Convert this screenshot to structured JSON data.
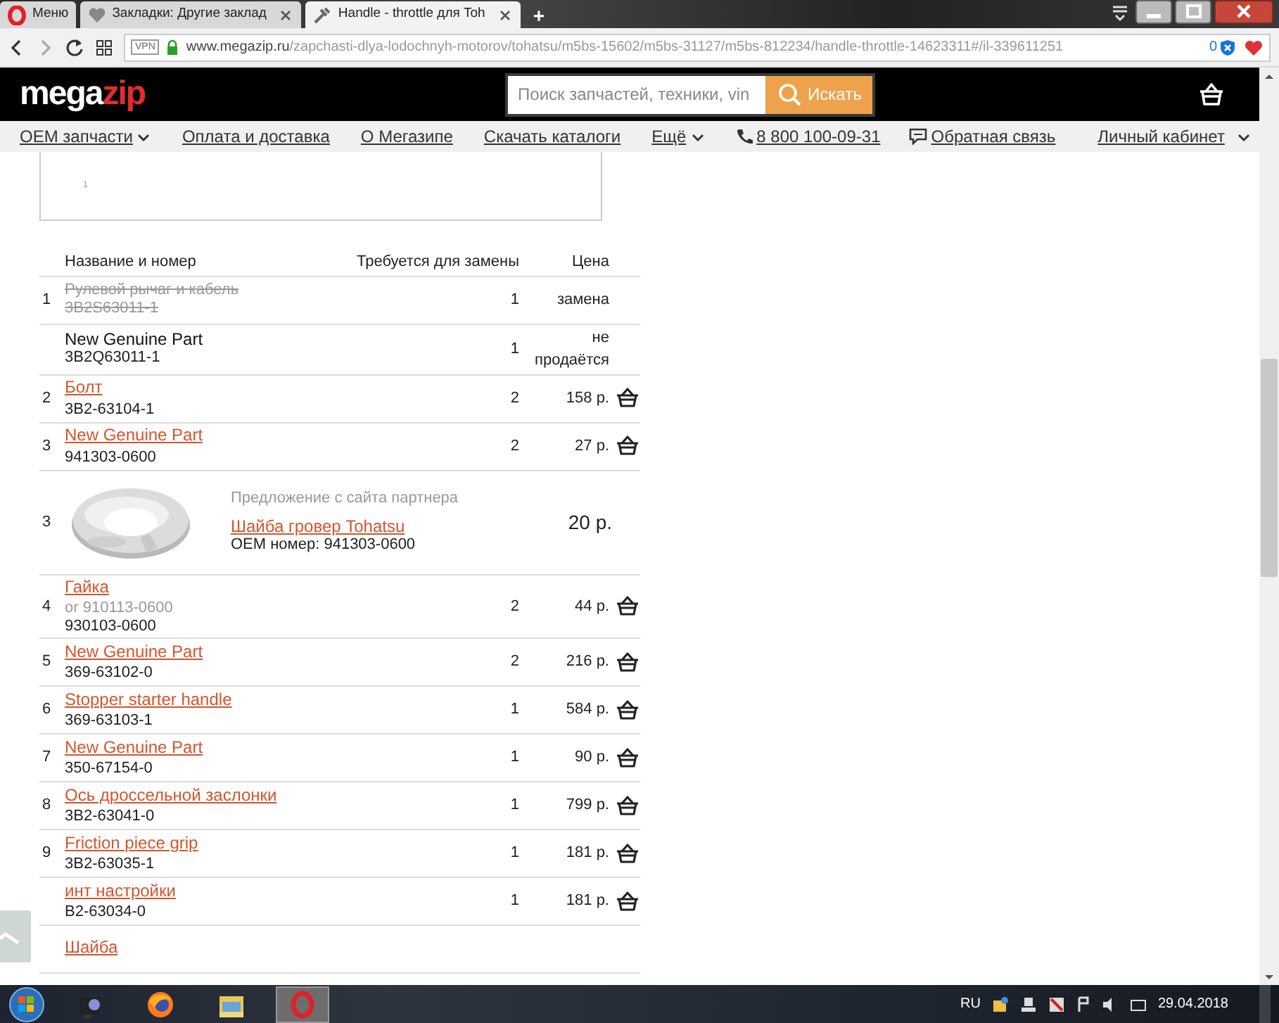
{
  "browser": {
    "tabs": [
      {
        "label": "Меню",
        "selected": false,
        "kind": "menu"
      },
      {
        "label": "Закладки: Другие заклад",
        "selected": false,
        "kind": "bookmarks"
      },
      {
        "label": "Handle - throttle для Toh",
        "selected": true,
        "kind": "page"
      }
    ],
    "new_tab": "+",
    "address": {
      "vpn": "VPN",
      "host": "www.megazip.ru",
      "path": "/zapchasti-dlya-lodochnyh-motorov/tohatsu/m5bs-15602/m5bs-31127/m5bs-812234/handle-throttle-14623311#/il-339611251",
      "blocked_count": "0"
    }
  },
  "site": {
    "logo": {
      "first": "mega",
      "second": "zip"
    },
    "search": {
      "placeholder": "Поиск запчастей, техники, vin",
      "button": "Искать"
    },
    "nav": [
      {
        "label": "OEM запчасти",
        "dropdown": true
      },
      {
        "label": "Оплата и доставка",
        "dropdown": false
      },
      {
        "label": "О Мегазипе",
        "dropdown": false
      },
      {
        "label": "Скачать каталоги",
        "dropdown": false
      },
      {
        "label": "Ещё",
        "dropdown": true
      }
    ],
    "nav_right": [
      {
        "label": "8 800 100-09-31",
        "kind": "phone"
      },
      {
        "label": "Обратная связь",
        "kind": "chat"
      },
      {
        "label": "Личный кабинет",
        "kind": "dropdown"
      }
    ]
  },
  "image_box": {
    "caption": "1"
  },
  "table": {
    "columns": [
      "Название и номер",
      "Требуется для замены",
      "Цена"
    ],
    "rows": [
      {
        "kind": "replaced",
        "number": "1",
        "name": "Рулевой рычаг и кабель",
        "code": "3B2S63011-1",
        "quantity": "1",
        "price": "замена"
      },
      {
        "kind": "unavailable",
        "name": "New Genuine Part",
        "code": "3B2Q63011-1",
        "quantity": "1",
        "price": "не продаётся"
      },
      {
        "kind": "part",
        "number": "2",
        "name": "Болт",
        "code": "3B2-63104-1",
        "quantity": "2",
        "price": "158 р."
      },
      {
        "kind": "part",
        "number": "3",
        "name": "New Genuine Part",
        "code": "941303-0600",
        "quantity": "2",
        "price": "27 р."
      },
      {
        "kind": "offer",
        "number": "3",
        "note": "Предложение с сайта партнера",
        "name": "Шайба гровер Tohatsu",
        "oem_number": "OEM номер: 941303-0600",
        "price": "20 р."
      },
      {
        "kind": "part",
        "number": "4",
        "name": "Гайка",
        "alt_code": "or 910113-0600",
        "code": "930103-0600",
        "quantity": "2",
        "price": "44 р."
      },
      {
        "kind": "part",
        "number": "5",
        "name": "New Genuine Part",
        "code": "369-63102-0",
        "quantity": "2",
        "price": "216 р."
      },
      {
        "kind": "part",
        "number": "6",
        "name": "Stopper starter handle",
        "code": "369-63103-1",
        "quantity": "1",
        "price": "584 р."
      },
      {
        "kind": "part",
        "number": "7",
        "name": "New Genuine Part",
        "code": "350-67154-0",
        "quantity": "1",
        "price": "90 р."
      },
      {
        "kind": "part",
        "number": "8",
        "name": "Ось дроссельной заслонки",
        "code": "3B2-63041-0",
        "quantity": "1",
        "price": "799 р."
      },
      {
        "kind": "part",
        "number": "9",
        "name": "Friction piece grip",
        "code": "3B2-63035-1",
        "quantity": "1",
        "price": "181 р."
      },
      {
        "kind": "part",
        "name": "инт настройки",
        "code": "B2-63034-0",
        "quantity": "1",
        "price": "181 р."
      },
      {
        "kind": "part",
        "name": "Шайба"
      }
    ]
  },
  "taskbar": {
    "apps": [
      {
        "kind": "camera",
        "selected": false
      },
      {
        "kind": "firefox",
        "selected": false
      },
      {
        "kind": "folder",
        "selected": false
      },
      {
        "kind": "opera",
        "selected": true
      }
    ],
    "language": "RU",
    "date": "29.04.2018"
  }
}
